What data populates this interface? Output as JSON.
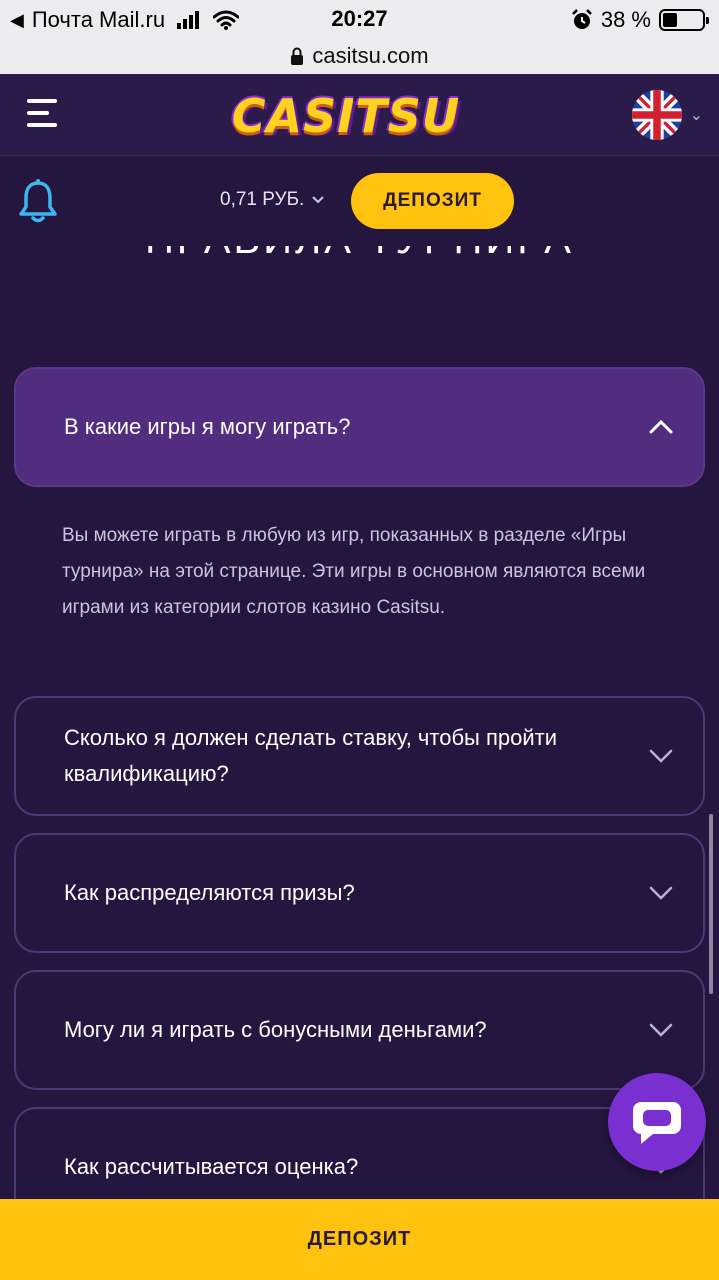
{
  "status_bar": {
    "back_app": "Почта Mail.ru",
    "time": "20:27",
    "battery": "38 %",
    "battery_level": 0.38
  },
  "browser": {
    "url": "casitsu.com"
  },
  "header": {
    "logo_text": "CASITSU",
    "language_flag": "uk-flag-icon"
  },
  "account": {
    "balance": "0,71 РУБ.",
    "deposit_label": "ДЕПОЗИТ"
  },
  "page": {
    "title": "ПРАВИЛА ТУРНИРА"
  },
  "faq": [
    {
      "question": "В какие игры я могу играть?",
      "expanded": true,
      "answer": "Вы можете играть в любую из игр, показанных в разделе «Игры турнира» на этой странице. Эти игры в основном являются всеми играми из категории слотов казино Casitsu."
    },
    {
      "question": "Сколько я должен сделать ставку, чтобы пройти квалификацию?",
      "expanded": false
    },
    {
      "question": "Как распределяются призы?",
      "expanded": false
    },
    {
      "question": "Могу ли я играть с бонусными деньгами?",
      "expanded": false
    },
    {
      "question": "Как рассчитывается оценка?",
      "expanded": false
    }
  ],
  "bottom_bar": {
    "deposit_label": "ДЕПОЗИТ"
  },
  "colors": {
    "background": "#251640",
    "header": "#2b1b4a",
    "accent": "#ffc20e",
    "faq_open": "#522c7e",
    "chat": "#7a2fd0"
  }
}
